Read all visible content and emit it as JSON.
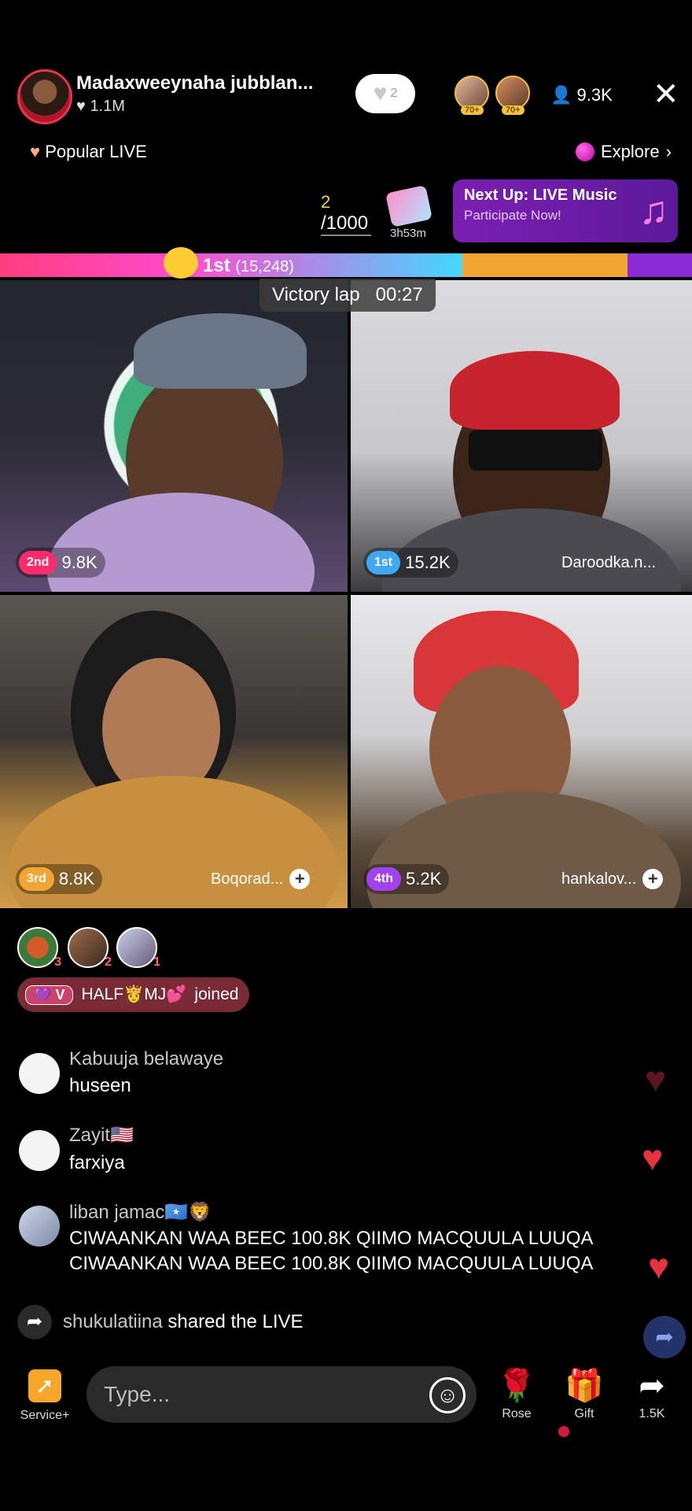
{
  "header": {
    "host_name": "Madaxweeynaha jubblan...",
    "host_likes": "1.1M",
    "follow_count": "2",
    "viewer_badges": [
      "70+",
      "70+"
    ],
    "viewer_count": "9.3K"
  },
  "tabs": {
    "popular_label": "Popular LIVE",
    "explore_label": "Explore"
  },
  "goal": {
    "current": "2",
    "target": "/1000",
    "timer": "3h53m"
  },
  "next_up": {
    "title": "Next Up: LIVE Music",
    "subtitle": "Participate Now!"
  },
  "battle": {
    "leader_label": "1st",
    "leader_score": "(15,248)",
    "victory_label": "Victory lap",
    "victory_time": "00:27",
    "first_share": 0.668,
    "second_share": 0.239
  },
  "participants": [
    {
      "rank": "2nd",
      "score": "9.8K",
      "name": ""
    },
    {
      "rank": "1st",
      "score": "15.2K",
      "name": "Daroodka.n..."
    },
    {
      "rank": "3rd",
      "score": "8.8K",
      "name": "Boqorad..."
    },
    {
      "rank": "4th",
      "score": "5.2K",
      "name": "hankalov..."
    }
  ],
  "gifters": [
    "3",
    "2",
    "1"
  ],
  "joined": {
    "level": "V",
    "user": "HALF👸MJ💕",
    "text": "joined"
  },
  "chat": [
    {
      "user": "Kabuuja belawaye",
      "message": "huseen"
    },
    {
      "user": "Zayit🇺🇸",
      "message": "farxiya"
    },
    {
      "user": "liban jamac🇸🇴🦁",
      "message": "CIWAANKAN WAA BEEC 100.8K QIIMO MACQUULA LUUQA",
      "message2": "CIWAANKAN WAA BEEC 100.8K QIIMO MACQUULA LUUQA"
    }
  ],
  "share": {
    "user": "shukulatiina",
    "text": "shared the LIVE"
  },
  "bottom": {
    "service_label": "Service+",
    "input_placeholder": "Type...",
    "rose_label": "Rose",
    "gift_label": "Gift",
    "share_count": "1.5K"
  },
  "colors": {
    "accent_pink": "#ff3e7c",
    "battle_orange": "#f2a532",
    "battle_purple": "#8a2bd6",
    "next_up_bg": "#7a1fb2"
  },
  "icons": [
    "close-icon",
    "heart-icon",
    "person-icon",
    "chevron-right-icon",
    "music-icon",
    "share-icon",
    "smile-icon",
    "rose-icon",
    "gift-icon",
    "service-icon"
  ]
}
